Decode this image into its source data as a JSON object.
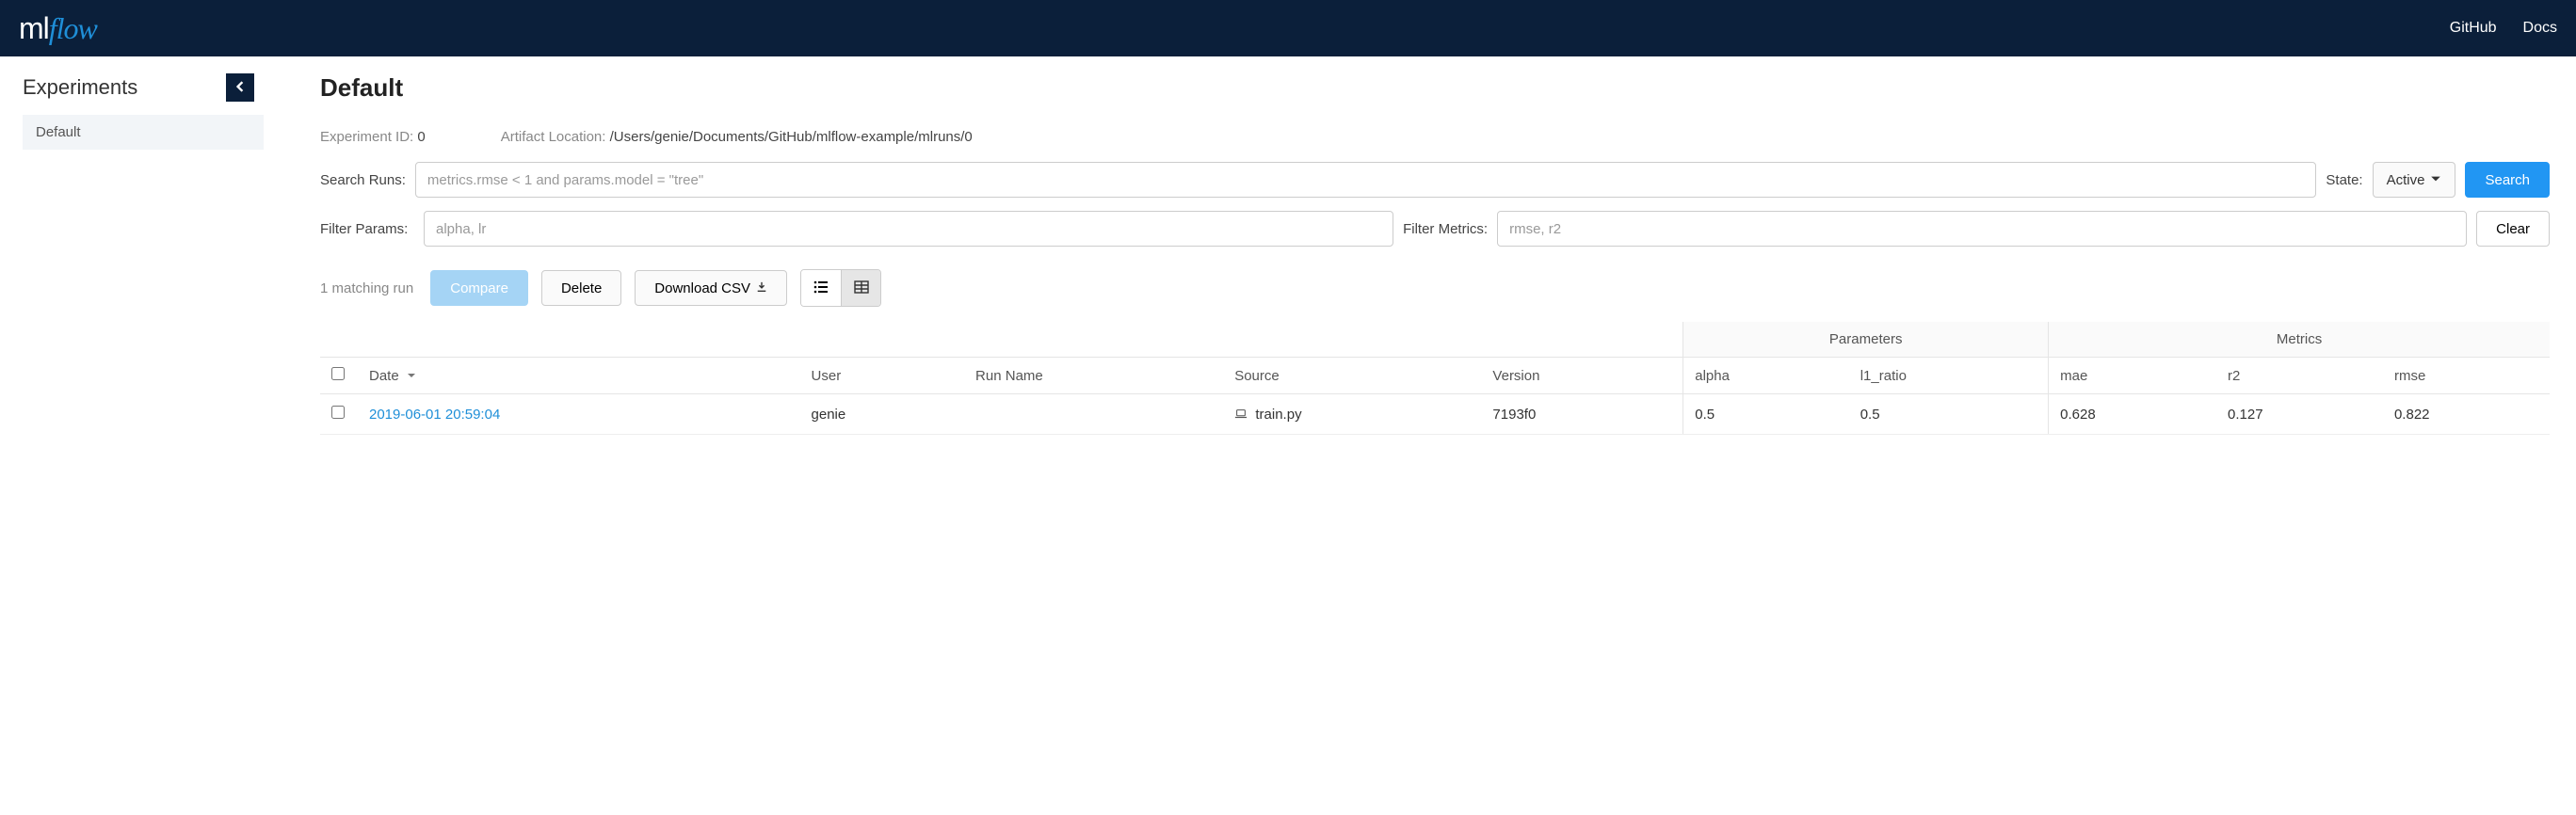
{
  "nav": {
    "github": "GitHub",
    "docs": "Docs"
  },
  "sidebar": {
    "title": "Experiments",
    "items": [
      {
        "label": "Default"
      }
    ]
  },
  "page": {
    "title": "Default",
    "experiment_id_label": "Experiment ID:",
    "experiment_id": "0",
    "artifact_label": "Artifact Location:",
    "artifact_location": "/Users/genie/Documents/GitHub/mlflow-example/mlruns/0"
  },
  "search": {
    "label": "Search Runs:",
    "placeholder": "metrics.rmse < 1 and params.model = \"tree\"",
    "state_label": "State:",
    "state_value": "Active",
    "search_btn": "Search"
  },
  "filter": {
    "params_label": "Filter Params:",
    "params_placeholder": "alpha, lr",
    "metrics_label": "Filter Metrics:",
    "metrics_placeholder": "rmse, r2",
    "clear_btn": "Clear"
  },
  "toolbar": {
    "count": "1 matching run",
    "compare": "Compare",
    "delete": "Delete",
    "download": "Download CSV"
  },
  "table": {
    "group_params": "Parameters",
    "group_metrics": "Metrics",
    "cols": {
      "date": "Date",
      "user": "User",
      "run_name": "Run Name",
      "source": "Source",
      "version": "Version",
      "alpha": "alpha",
      "l1_ratio": "l1_ratio",
      "mae": "mae",
      "r2": "r2",
      "rmse": "rmse"
    },
    "rows": [
      {
        "date": "2019-06-01 20:59:04",
        "user": "genie",
        "run_name": "",
        "source": "train.py",
        "version": "7193f0",
        "alpha": "0.5",
        "l1_ratio": "0.5",
        "mae": "0.628",
        "r2": "0.127",
        "rmse": "0.822"
      }
    ]
  }
}
